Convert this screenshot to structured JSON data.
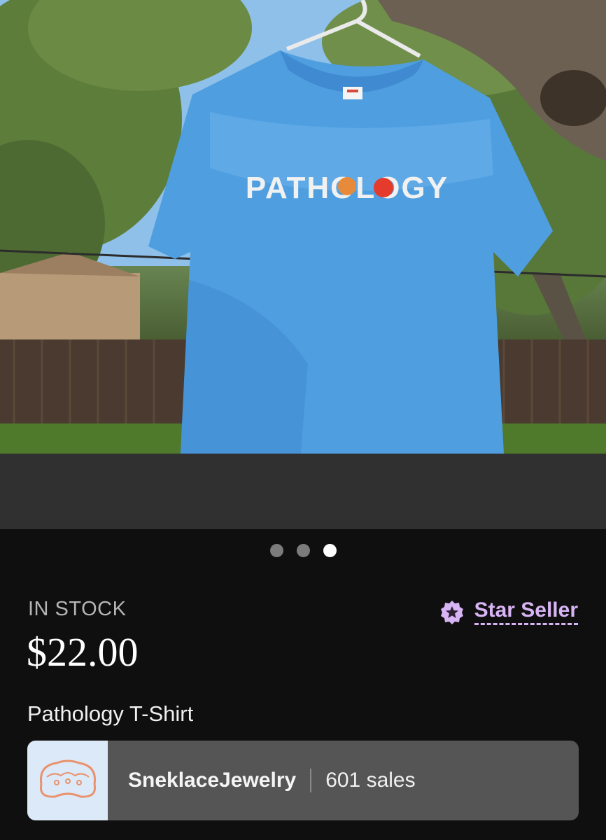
{
  "product": {
    "stock_status": "IN STOCK",
    "price": "$22.00",
    "title": "Pathology T-Shirt",
    "shirt_print": "PATHOLOGY"
  },
  "badge": {
    "label": "Star Seller",
    "icon": "star-badge-icon",
    "color": "#d7b4f3"
  },
  "carousel": {
    "count": 3,
    "active_index": 2
  },
  "shop": {
    "name": "SneklaceJewelry",
    "sales": "601 sales"
  }
}
